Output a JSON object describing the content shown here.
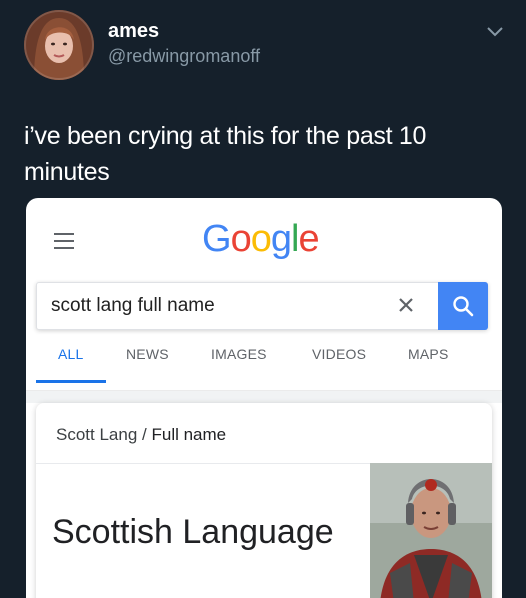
{
  "tweet": {
    "display_name": "ames",
    "handle": "@redwingromanoff",
    "text": "i’ve been crying at this for the past 10 minutes",
    "menu_icon": "chevron-down-icon"
  },
  "google": {
    "logo_letters": [
      {
        "char": "G",
        "color": "#4285f4"
      },
      {
        "char": "o",
        "color": "#ea4335"
      },
      {
        "char": "o",
        "color": "#fbbc05"
      },
      {
        "char": "g",
        "color": "#4285f4"
      },
      {
        "char": "l",
        "color": "#34a853"
      },
      {
        "char": "e",
        "color": "#ea4335"
      }
    ],
    "search": {
      "value": "scott lang full name",
      "clear_symbol": "×",
      "button_icon": "search-icon",
      "button_color": "#4285f4"
    },
    "tabs": [
      {
        "label": "ALL",
        "active": true
      },
      {
        "label": "NEWS",
        "active": false
      },
      {
        "label": "IMAGES",
        "active": false
      },
      {
        "label": "VIDEOS",
        "active": false
      },
      {
        "label": "MAPS",
        "active": false
      }
    ],
    "result": {
      "breadcrumb_subject": "Scott Lang",
      "breadcrumb_separator": "/",
      "breadcrumb_attribute": "Full name",
      "answer": "Scottish Language",
      "thumbnail_icon": "ant-man-photo"
    }
  },
  "colors": {
    "background": "#15202b",
    "handle": "#8899a6",
    "accent": "#1a73e8"
  }
}
